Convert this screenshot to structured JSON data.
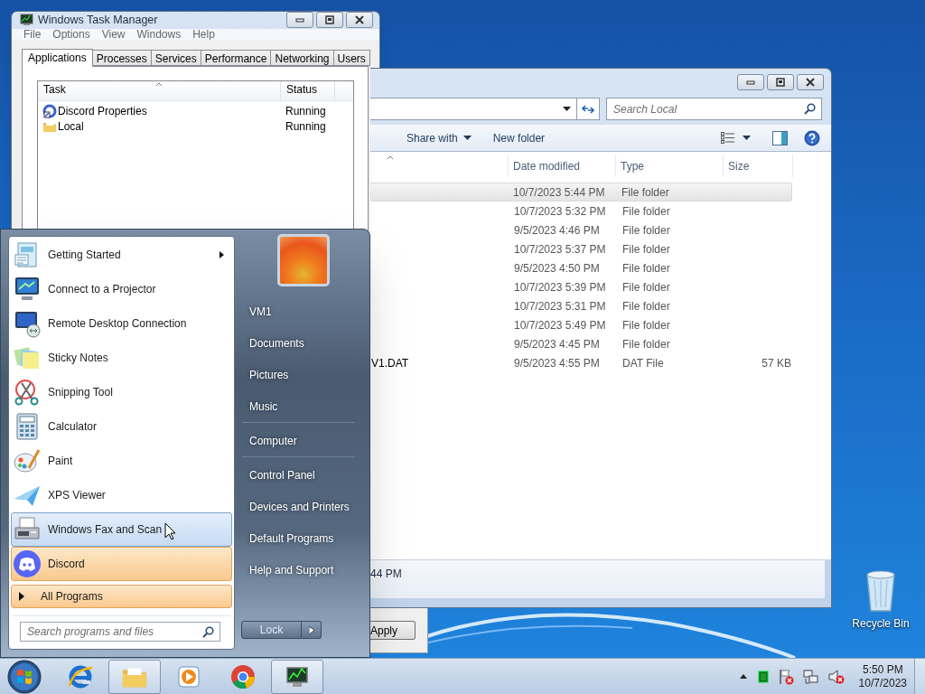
{
  "desktop": {
    "icons": [
      {
        "kind": "recycle-bin",
        "label": "Recycle Bin"
      }
    ]
  },
  "task_manager": {
    "title": "Windows Task Manager",
    "menu": [
      "File",
      "Options",
      "View",
      "Windows",
      "Help"
    ],
    "tabs": [
      {
        "label": "Applications",
        "selected": true
      },
      {
        "label": "Processes",
        "selected": false
      },
      {
        "label": "Services",
        "selected": false
      },
      {
        "label": "Performance",
        "selected": false
      },
      {
        "label": "Networking",
        "selected": false
      },
      {
        "label": "Users",
        "selected": false
      }
    ],
    "columns": [
      "Task",
      "Status"
    ],
    "rows": [
      {
        "kind": "app",
        "task": "Discord Properties",
        "status": "Running"
      },
      {
        "kind": "folder",
        "task": "Local",
        "status": "Running"
      }
    ]
  },
  "explorer": {
    "search": {
      "placeholder": "Search Local"
    },
    "toolbar": [
      {
        "label": "Share with",
        "dropdown": true
      },
      {
        "label": "New folder",
        "dropdown": false
      }
    ],
    "columns": [
      "Date modified",
      "Type",
      "Size"
    ],
    "rows": [
      {
        "date": "10/7/2023 5:44 PM",
        "type": "File folder",
        "selected": true
      },
      {
        "date": "10/7/2023 5:32 PM",
        "type": "File folder",
        "selected": false
      },
      {
        "date": "9/5/2023 4:46 PM",
        "type": "File folder",
        "selected": false
      },
      {
        "date": "10/7/2023 5:37 PM",
        "type": "File folder",
        "selected": false
      },
      {
        "date": "9/5/2023 4:50 PM",
        "type": "File folder",
        "selected": false
      },
      {
        "date": "10/7/2023 5:39 PM",
        "type": "File folder",
        "selected": false
      },
      {
        "date": "10/7/2023 5:31 PM",
        "type": "File folder",
        "selected": false
      },
      {
        "date": "10/7/2023 5:49 PM",
        "type": "File folder",
        "selected": false
      },
      {
        "date": "9/5/2023 4:45 PM",
        "type": "File folder",
        "selected": false
      },
      {
        "name": "V1.DAT",
        "date": "9/5/2023 4:55 PM",
        "type": "DAT File",
        "size": "57 KB",
        "selected": false
      }
    ],
    "details": "44 PM"
  },
  "dialog": {
    "buttons": [
      "Apply"
    ]
  },
  "start_menu": {
    "programs": [
      {
        "kind": "getting-started",
        "label": "Getting Started",
        "submenu": true,
        "hovered": false,
        "new": false
      },
      {
        "kind": "projector",
        "label": "Connect to a Projector",
        "submenu": false,
        "hovered": false,
        "new": false
      },
      {
        "kind": "remote",
        "label": "Remote Desktop Connection",
        "submenu": false,
        "hovered": false,
        "new": false
      },
      {
        "kind": "sticky",
        "label": "Sticky Notes",
        "submenu": false,
        "hovered": false,
        "new": false
      },
      {
        "kind": "snipping",
        "label": "Snipping Tool",
        "submenu": false,
        "hovered": false,
        "new": false
      },
      {
        "kind": "calculator",
        "label": "Calculator",
        "submenu": false,
        "hovered": false,
        "new": false
      },
      {
        "kind": "paint",
        "label": "Paint",
        "submenu": false,
        "hovered": false,
        "new": false
      },
      {
        "kind": "xps",
        "label": "XPS Viewer",
        "submenu": false,
        "hovered": false,
        "new": false
      },
      {
        "kind": "fax",
        "label": "Windows Fax and Scan",
        "submenu": false,
        "hovered": true,
        "new": false
      },
      {
        "kind": "discord",
        "label": "Discord",
        "submenu": false,
        "hovered": false,
        "new": true
      }
    ],
    "all_programs": {
      "label": "All Programs",
      "new": true
    },
    "search": {
      "placeholder": "Search programs and files"
    },
    "places": [
      {
        "label": "VM1",
        "separator_after": false
      },
      {
        "label": "Documents",
        "separator_after": false
      },
      {
        "label": "Pictures",
        "separator_after": false
      },
      {
        "label": "Music",
        "separator_after": true
      },
      {
        "label": "Computer",
        "separator_after": true
      },
      {
        "label": "Control Panel",
        "separator_after": false
      },
      {
        "label": "Devices and Printers",
        "separator_after": false
      },
      {
        "label": "Default Programs",
        "separator_after": false
      },
      {
        "label": "Help and Support",
        "separator_after": false
      }
    ],
    "power_button": "Lock"
  },
  "taskbar": {
    "apps": [
      {
        "kind": "ie",
        "running": false
      },
      {
        "kind": "explorer",
        "running": true
      },
      {
        "kind": "media",
        "running": false
      },
      {
        "kind": "chrome",
        "running": false
      },
      {
        "kind": "taskmgr",
        "running": true
      }
    ],
    "tray": {
      "action_center_alert": true,
      "volume_muted": true
    },
    "clock": {
      "time": "5:50 PM",
      "date": "10/7/2023"
    }
  }
}
